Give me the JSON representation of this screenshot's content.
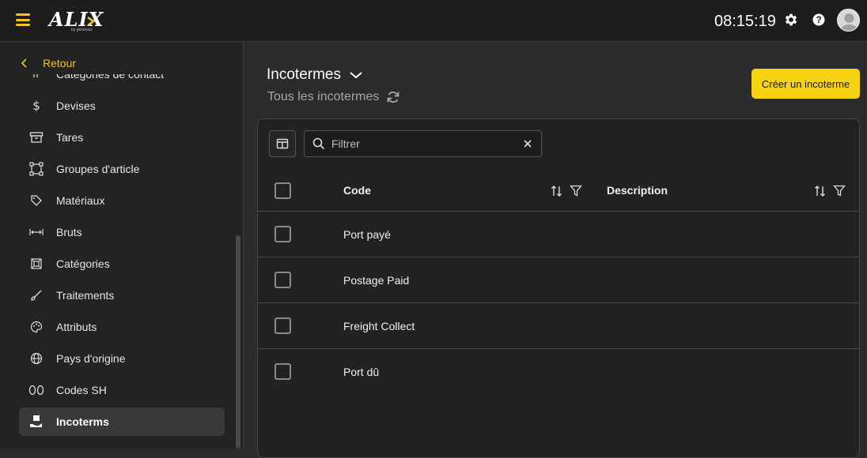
{
  "topbar": {
    "logo_text": "ALIX",
    "logo_sub": "by gkmouss",
    "clock": "08:15:19",
    "icons": [
      "menu-icon",
      "gear-icon",
      "help-icon",
      "avatar"
    ],
    "accent": "#f5c518"
  },
  "sidebar": {
    "back_label": "Retour",
    "items": [
      {
        "label": "Catégories de contact",
        "icon": "contact-category-icon"
      },
      {
        "label": "Devises",
        "icon": "dollar-icon"
      },
      {
        "label": "Tares",
        "icon": "archive-icon"
      },
      {
        "label": "Groupes d'article",
        "icon": "group-icon"
      },
      {
        "label": "Matériaux",
        "icon": "tag-icon"
      },
      {
        "label": "Bruts",
        "icon": "width-arrows-icon"
      },
      {
        "label": "Catégories",
        "icon": "category-icon"
      },
      {
        "label": "Traitements",
        "icon": "brush-icon"
      },
      {
        "label": "Attributs",
        "icon": "palette-icon"
      },
      {
        "label": "Pays d'origine",
        "icon": "globe-icon"
      },
      {
        "label": "Codes SH",
        "icon": "double-zero-icon"
      },
      {
        "label": "Incoterms",
        "icon": "hand-box-icon"
      }
    ],
    "active_index": 11
  },
  "main": {
    "title": "Incotermes",
    "subtitle": "Tous les incotermes",
    "create_button": "Créer un incoterme",
    "filter_placeholder": "Filtrer",
    "columns": [
      "Code",
      "Description"
    ],
    "rows": [
      {
        "code": "Port payé",
        "description": ""
      },
      {
        "code": "Postage Paid",
        "description": ""
      },
      {
        "code": "Freight Collect",
        "description": ""
      },
      {
        "code": "Port dû",
        "description": ""
      }
    ]
  }
}
